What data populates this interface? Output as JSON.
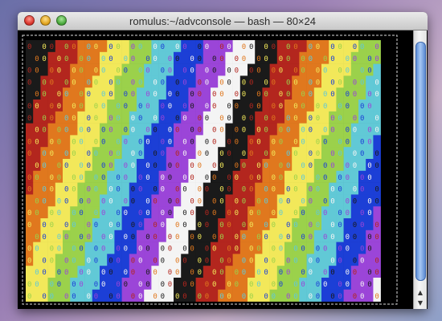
{
  "window": {
    "title": "romulus:~/advconsole — bash — 80×24"
  },
  "terminal": {
    "cell_text": "0",
    "background": "#000000",
    "stripe_colors": [
      "#1a1a1a",
      "#b3261e",
      "#e0781e",
      "#f2e85a",
      "#9bd14b",
      "#61c9d6",
      "#1c3fd6",
      "#9b45d8",
      "#f4f4f4"
    ]
  },
  "icons": {
    "close": "close-icon",
    "minimize": "minimize-icon",
    "zoom": "zoom-icon",
    "scroll_up": "arrow-up-icon",
    "scroll_down": "arrow-down-icon"
  },
  "scrollbar": {
    "up_glyph": "▲",
    "down_glyph": "▼"
  }
}
